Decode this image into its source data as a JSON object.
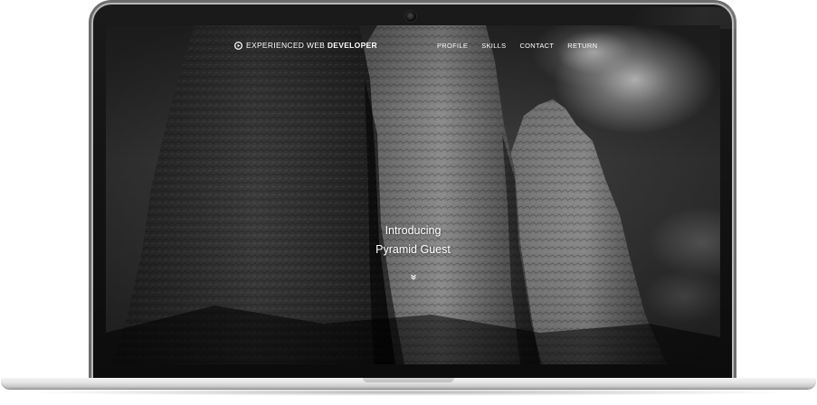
{
  "nav": {
    "brand_prefix": "EXPERIENCED WEB",
    "brand_strong": "DEVELOPER",
    "items": [
      {
        "label": "PROFILE"
      },
      {
        "label": "SKILLS"
      },
      {
        "label": "CONTACT"
      },
      {
        "label": "RETURN"
      }
    ]
  },
  "hero": {
    "line1": "Introducing",
    "line2": "Pyramid Guest"
  },
  "icons": {
    "brand": "play-circle-icon",
    "scroll": "chevron-down-icon"
  },
  "colors": {
    "nav_text": "#ffffff",
    "hero_text": "#ffffff",
    "bezel": "#111111",
    "base": "#e3e3e3"
  }
}
